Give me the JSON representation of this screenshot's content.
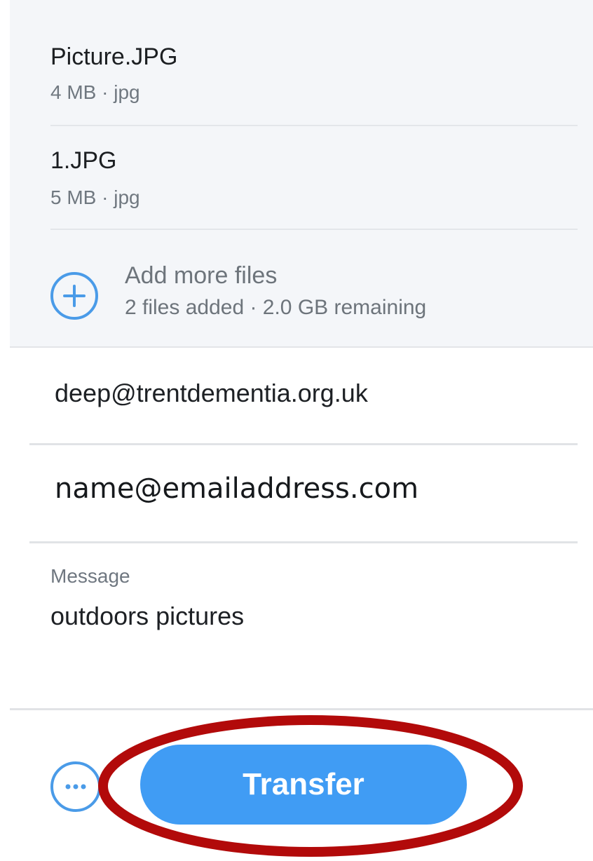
{
  "files": [
    {
      "name": "Picture.JPG",
      "meta": "4 MB · jpg"
    },
    {
      "name": "1.JPG",
      "meta": "5 MB · jpg"
    }
  ],
  "add_more": {
    "title": "Add more files",
    "subtitle": "2 files added · 2.0 GB remaining"
  },
  "from_field": {
    "value": "deep@trentdementia.org.uk"
  },
  "to_field": {
    "value": "name@emailaddress.com"
  },
  "message": {
    "label": "Message",
    "value": "outdoors pictures"
  },
  "transfer_button": {
    "label": "Transfer"
  },
  "colors": {
    "accent": "#409cf4",
    "icon_blue": "#4a9be8",
    "highlight": "#b20a0a",
    "panel_bg": "#f4f6f9"
  },
  "icons": {
    "add": "plus-circle-icon",
    "more": "more-options-icon"
  }
}
